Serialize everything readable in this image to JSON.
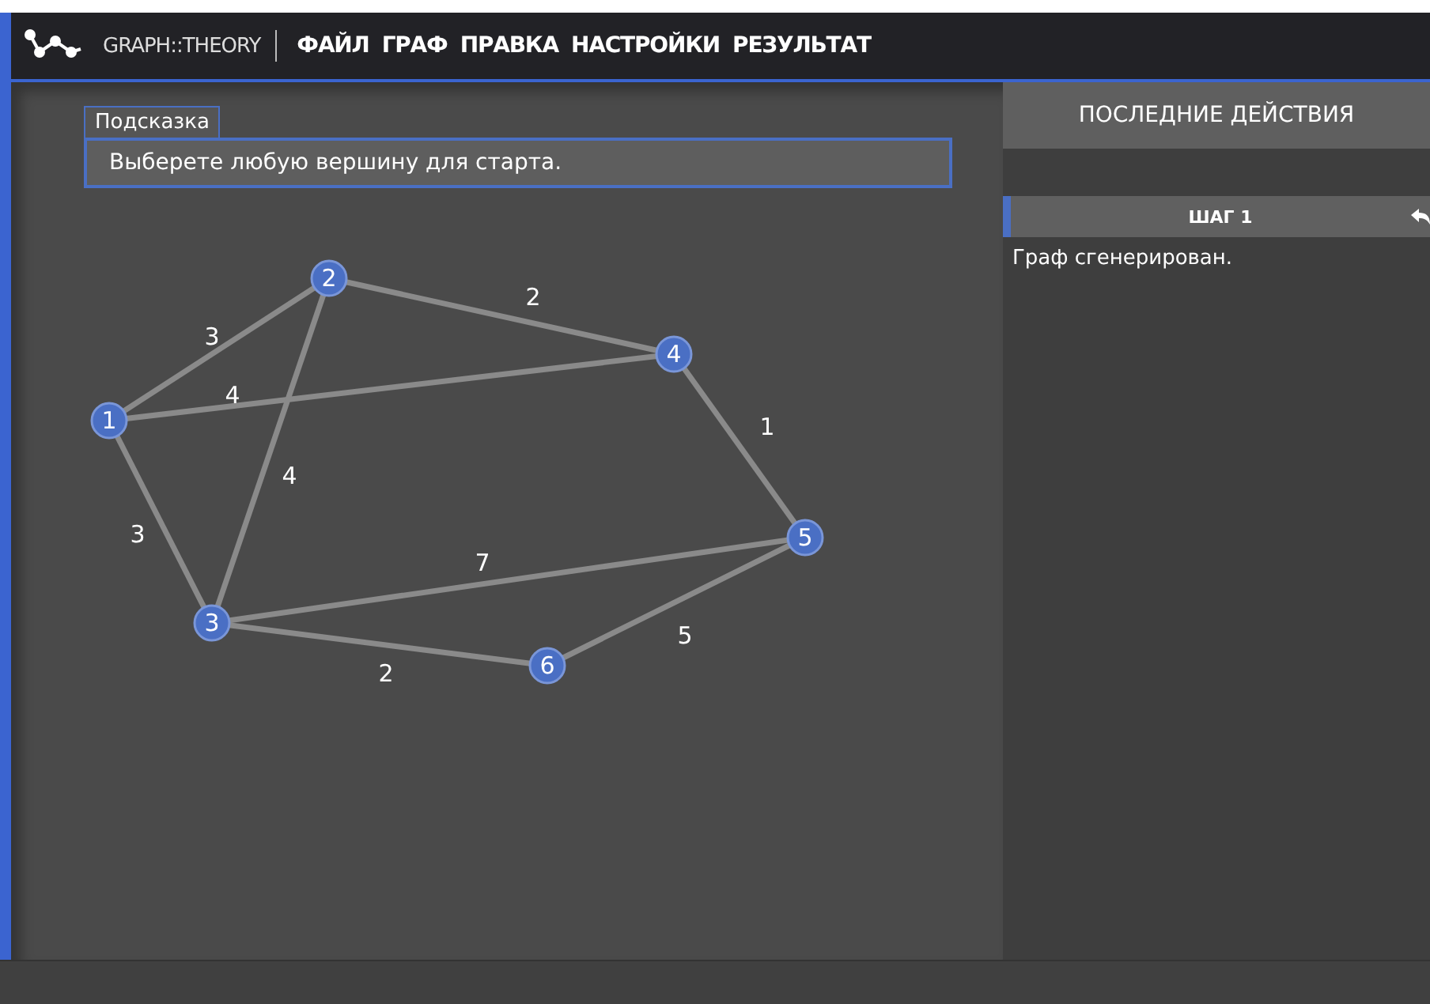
{
  "header": {
    "app_title": "GRAPH::THEORY",
    "menu": [
      "ФАЙЛ",
      "ГРАФ",
      "ПРАВКА",
      "НАСТРОЙКИ",
      "РЕЗУЛЬТАТ"
    ]
  },
  "hint": {
    "tab": "Подсказка",
    "text": "Выберете любую вершину для старта."
  },
  "graph": {
    "nodes": [
      "1",
      "2",
      "3",
      "4",
      "5",
      "6"
    ],
    "edges": [
      {
        "weight": "3"
      },
      {
        "weight": "4"
      },
      {
        "weight": "3"
      },
      {
        "weight": "2"
      },
      {
        "weight": "4"
      },
      {
        "weight": "1"
      },
      {
        "weight": "7"
      },
      {
        "weight": "2"
      },
      {
        "weight": "5"
      }
    ]
  },
  "history": {
    "title": "ПОСЛЕДНИЕ ДЕЙСТВИЯ",
    "steps": [
      {
        "title": "ШАГ 1",
        "text": "Граф сгенерирован."
      }
    ]
  }
}
